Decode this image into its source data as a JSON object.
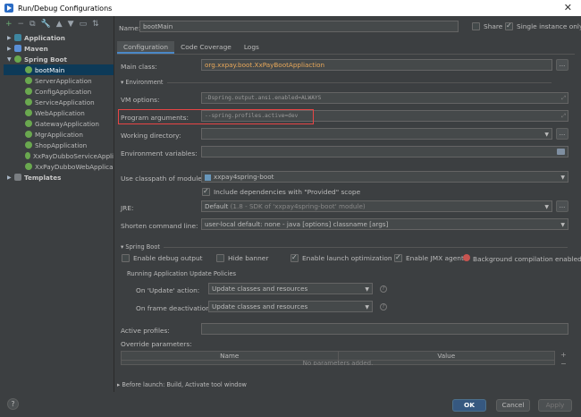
{
  "window": {
    "title": "Run/Debug Configurations",
    "close": "✕"
  },
  "toolbar": {
    "add": "+",
    "remove": "−",
    "copy": "⧉",
    "settings": "🔧",
    "up": "▲",
    "down": "▼",
    "folder": "▭",
    "sort": "⇅"
  },
  "tree": [
    {
      "label": "Application",
      "bold": true,
      "arrow": "▶"
    },
    {
      "label": "Maven",
      "bold": true,
      "arrow": "▶"
    },
    {
      "label": "Spring Boot",
      "bold": true,
      "arrow": "▼"
    },
    {
      "label": "bootMain",
      "selected": true
    },
    {
      "label": "ServerApplication"
    },
    {
      "label": "ConfigApplication"
    },
    {
      "label": "ServiceApplication"
    },
    {
      "label": "WebApplication"
    },
    {
      "label": "GatewayApplication"
    },
    {
      "label": "MgrApplication"
    },
    {
      "label": "ShopApplication"
    },
    {
      "label": "XxPayDubboServiceAppli"
    },
    {
      "label": "XxPayDubboWebApplica"
    },
    {
      "label": "Templates",
      "bold": true,
      "arrow": "▶"
    }
  ],
  "header": {
    "name_label": "Name:",
    "name_value": "bootMain",
    "share_label": "Share",
    "single_label": "Single instance only"
  },
  "tabs": [
    "Configuration",
    "Code Coverage",
    "Logs"
  ],
  "form": {
    "main_class_label": "Main class:",
    "main_class_value": "org.xxpay.boot.XxPayBootAppliaction",
    "environment_section": "Environment",
    "vm_label": "VM options:",
    "vm_value": "-Dspring.output.ansi.enabled=ALWAYS",
    "program_args_label": "Program arguments:",
    "program_args_value": "--spring.profiles.active=dev",
    "working_dir_label": "Working directory:",
    "env_vars_label": "Environment variables:",
    "classpath_label": "Use classpath of module:",
    "classpath_value": "xxpay4spring-boot",
    "include_label": "Include dependencies with \"Provided\" scope",
    "jre_label": "JRE:",
    "jre_value": "Default",
    "jre_detail": "(1.8 - SDK of 'xxpay4spring-boot' module)",
    "shorten_label": "Shorten command line:",
    "shorten_value": "user-local default: none - java [options] classname [args]",
    "springboot_section": "Spring Boot",
    "debug_output": "Enable debug output",
    "hide_banner": "Hide banner",
    "launch_opt": "Enable launch optimization",
    "jmx_agent": "Enable JMX agent",
    "bg_compile": "Background compilation enabled",
    "update_policies": "Running Application Update Policies",
    "on_update_label": "On 'Update' action:",
    "on_update_value": "Update classes and resources",
    "on_frame_label": "On frame deactivation:",
    "on_frame_value": "Update classes and resources",
    "active_profiles_label": "Active profiles:",
    "override_label": "Override parameters:",
    "col_name": "Name",
    "col_value": "Value",
    "no_params": "No parameters added.",
    "before_launch": "Before launch: Build, Activate tool window"
  },
  "buttons": {
    "help": "?",
    "ok": "OK",
    "cancel": "Cancel",
    "apply": "Apply",
    "browse": "...",
    "expand": "⤢",
    "dd": "▼",
    "plus": "+",
    "minus": "−",
    "qmark": "?"
  }
}
